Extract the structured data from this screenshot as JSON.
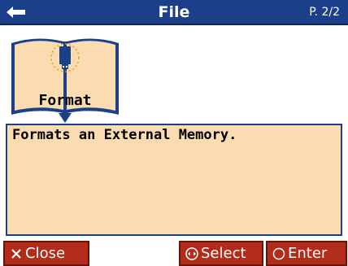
{
  "header": {
    "title": "File",
    "page_indicator": "P. 2/2"
  },
  "tile": {
    "label": "Format",
    "icon": "usb-memory-icon"
  },
  "description": "Formats an External Memory.",
  "footer": {
    "close_label": "Close",
    "select_label": "Select",
    "enter_label": "Enter"
  },
  "colors": {
    "titlebar": "#1c3f8a",
    "panel": "#fbdcb0",
    "button": "#b12c1a"
  }
}
